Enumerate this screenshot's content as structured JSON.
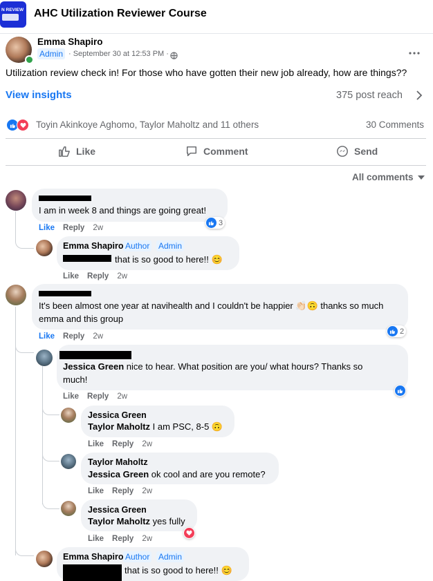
{
  "group": {
    "title": "AHC Utilization Reviewer Course",
    "thumb_text": "N REVIEW"
  },
  "post": {
    "author": "Emma Shapiro",
    "admin_badge": "Admin",
    "meta": "· September 30 at 12:53 PM ·",
    "text": "Utilization review check in! For those who have gotten their new job already, how are things??",
    "insights": "View insights",
    "reach": "375 post reach",
    "reactors": "Toyin Akinkoye Aghomo, Taylor Maholtz and 11 others",
    "comments_count": "30 Comments",
    "actions": {
      "like": "Like",
      "comment": "Comment",
      "send": "Send"
    },
    "sort": "All comments"
  },
  "labels": {
    "like": "Like",
    "reply": "Reply",
    "author": "Author",
    "admin": "Admin"
  },
  "comments": {
    "c1": {
      "text": "I am in week 8 and things are going great!",
      "time": "2w",
      "reactions": "3"
    },
    "c1r1": {
      "name": "Emma Shapiro",
      "text": "that is so good to here!! 😊",
      "time": "2w"
    },
    "c2": {
      "text": "It's been almost one year at navihealth and I couldn't be happier 👏🏻🙃 thanks so much emma and this group",
      "time": "2w",
      "reactions": "2"
    },
    "c2r1": {
      "mention": "Jessica Green",
      "text": " nice to hear. What position are you/ what hours? Thanks so much!",
      "time": "2w"
    },
    "c2r2": {
      "name": "Jessica Green",
      "mention": "Taylor Maholtz",
      "text": " I am PSC, 8-5 🙃",
      "time": "2w"
    },
    "c2r3": {
      "name": "Taylor Maholtz",
      "mention": "Jessica Green",
      "text": " ok cool and are you remote?",
      "time": "2w"
    },
    "c2r4": {
      "name": "Jessica Green",
      "mention": "Taylor Maholtz",
      "text": " yes fully",
      "time": "2w"
    },
    "c2r5": {
      "name": "Emma Shapiro",
      "text": "that is so good to here!! 😊"
    }
  },
  "colors": {
    "accent": "#1877f2",
    "bubble": "#f0f2f5",
    "secondary": "#65676b",
    "love": "#f33e58"
  }
}
